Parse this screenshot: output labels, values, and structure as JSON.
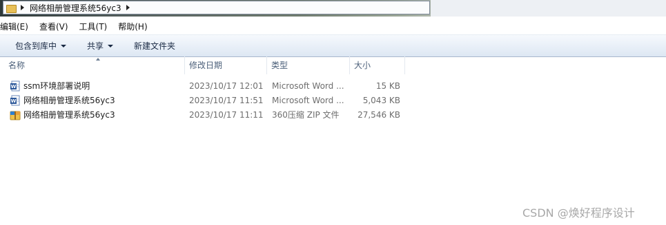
{
  "address": {
    "crumb": "网络相册管理系统56yc3"
  },
  "menu": [
    "编辑(E)",
    "查看(V)",
    "工具(T)",
    "帮助(H)"
  ],
  "toolbar": {
    "include_library": "包含到库中",
    "share": "共享",
    "new_folder": "新建文件夹"
  },
  "columns": {
    "name": "名称",
    "date": "修改日期",
    "type": "类型",
    "size": "大小"
  },
  "files": [
    {
      "name": "ssm环境部署说明",
      "date": "2023/10/17 12:01",
      "type": "Microsoft Word ...",
      "size": "15 KB",
      "icon": "word-doc-icon"
    },
    {
      "name": "网络相册管理系统56yc3",
      "date": "2023/10/17 11:51",
      "type": "Microsoft Word ...",
      "size": "5,043 KB",
      "icon": "word-doc-icon"
    },
    {
      "name": "网络相册管理系统56yc3",
      "date": "2023/10/17 11:11",
      "type": "360压缩 ZIP 文件",
      "size": "27,546 KB",
      "icon": "zip-archive-icon"
    }
  ],
  "watermark": "CSDN @焕好程序设计"
}
